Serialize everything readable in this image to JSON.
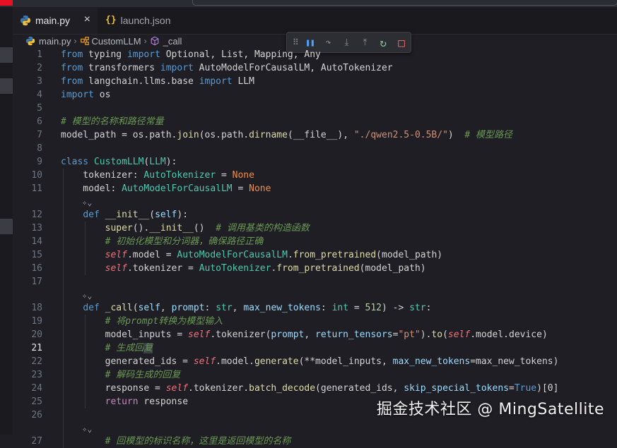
{
  "tabs": [
    {
      "label": "main.py",
      "close": "×",
      "active": true,
      "icon": "python-icon"
    },
    {
      "label": "launch.json",
      "icon": "json-braces-icon",
      "icon_glyph": "{}"
    }
  ],
  "breadcrumb": {
    "file": "main.py",
    "class": "CustomLLM",
    "method": "_call"
  },
  "debug_toolbar": {
    "grip": "⠿",
    "buttons": [
      {
        "name": "pause-icon",
        "glyph": "❚❚",
        "color": "#4fa3ff"
      },
      {
        "name": "step-over-icon",
        "glyph": "↷",
        "color": "#8a8a92"
      },
      {
        "name": "step-into-icon",
        "glyph": "⤓",
        "color": "#8a8a92"
      },
      {
        "name": "step-out-icon",
        "glyph": "⤒",
        "color": "#8a8a92"
      },
      {
        "name": "restart-icon",
        "glyph": "↻",
        "color": "#73c991"
      },
      {
        "name": "stop-icon",
        "glyph": "□",
        "color": "#f47067"
      }
    ]
  },
  "editor": {
    "current_line": 21,
    "lines": [
      {
        "n": "1",
        "t": [
          [
            "k",
            "from"
          ],
          [
            "pl",
            " typing "
          ],
          [
            "k",
            "import"
          ],
          [
            "pl",
            " Optional, List, Mapping, Any"
          ]
        ]
      },
      {
        "n": "2",
        "t": [
          [
            "k",
            "from"
          ],
          [
            "pl",
            " transformers "
          ],
          [
            "k",
            "import"
          ],
          [
            "pl",
            " AutoModelForCausalLM, AutoTokenizer"
          ]
        ]
      },
      {
        "n": "3",
        "t": [
          [
            "k",
            "from"
          ],
          [
            "pl",
            " langchain.llms.base "
          ],
          [
            "k",
            "import"
          ],
          [
            "pl",
            " LLM"
          ]
        ]
      },
      {
        "n": "4",
        "t": [
          [
            "k",
            "import"
          ],
          [
            "pl",
            " os"
          ]
        ]
      },
      {
        "n": "5",
        "t": []
      },
      {
        "n": "6",
        "t": [
          [
            "com",
            "# 模型的名称和路径常量"
          ]
        ]
      },
      {
        "n": "7",
        "t": [
          [
            "pl",
            "model_path = os.path."
          ],
          [
            "fn",
            "join"
          ],
          [
            "pl",
            "(os.path."
          ],
          [
            "fn",
            "dirname"
          ],
          [
            "pl",
            "(__file__), "
          ],
          [
            "str",
            "\"./qwen2.5-0.5B/\""
          ],
          [
            "pl",
            ")  "
          ],
          [
            "com",
            "# 模型路径"
          ]
        ]
      },
      {
        "n": "8",
        "t": []
      },
      {
        "n": "9",
        "t": [
          [
            "k",
            "class"
          ],
          [
            "pl",
            " "
          ],
          [
            "cls",
            "CustomLLM"
          ],
          [
            "pl",
            "("
          ],
          [
            "cls",
            "LLM"
          ],
          [
            "pl",
            "):"
          ]
        ]
      },
      {
        "n": "10",
        "t": [
          [
            "pl",
            "    tokenizer: "
          ],
          [
            "cls",
            "AutoTokenizer"
          ],
          [
            "pl",
            " = "
          ],
          [
            "none",
            "None"
          ]
        ]
      },
      {
        "n": "11",
        "t": [
          [
            "pl",
            "    model: "
          ],
          [
            "cls",
            "AutoModelForCausalLM"
          ],
          [
            "pl",
            " = "
          ],
          [
            "none",
            "None"
          ]
        ]
      },
      {
        "n": "12",
        "t": [
          [
            "pl",
            "    "
          ],
          [
            "k",
            "def"
          ],
          [
            "pl",
            " "
          ],
          [
            "fn",
            "__init__"
          ],
          [
            "pl",
            "("
          ],
          [
            "var",
            "self"
          ],
          [
            "pl",
            "):"
          ]
        ]
      },
      {
        "n": "13",
        "t": [
          [
            "pl",
            "        "
          ],
          [
            "fn",
            "super"
          ],
          [
            "pl",
            "()."
          ],
          [
            "fn",
            "__init__"
          ],
          [
            "pl",
            "()  "
          ],
          [
            "com",
            "# 调用基类的构造函数"
          ]
        ]
      },
      {
        "n": "14",
        "t": [
          [
            "pl",
            "        "
          ],
          [
            "com",
            "# 初始化模型和分词器，确保路径正确"
          ]
        ]
      },
      {
        "n": "15",
        "t": [
          [
            "pl",
            "        "
          ],
          [
            "self",
            "self"
          ],
          [
            "pl",
            ".model = "
          ],
          [
            "cls",
            "AutoModelForCausalLM"
          ],
          [
            "pl",
            "."
          ],
          [
            "fn",
            "from_pretrained"
          ],
          [
            "pl",
            "(model_path)"
          ]
        ]
      },
      {
        "n": "16",
        "t": [
          [
            "pl",
            "        "
          ],
          [
            "self",
            "self"
          ],
          [
            "pl",
            ".tokenizer = "
          ],
          [
            "cls",
            "AutoTokenizer"
          ],
          [
            "pl",
            "."
          ],
          [
            "fn",
            "from_pretrained"
          ],
          [
            "pl",
            "(model_path)"
          ]
        ]
      },
      {
        "n": "17",
        "t": []
      },
      {
        "n": "18",
        "t": [
          [
            "pl",
            "    "
          ],
          [
            "k",
            "def"
          ],
          [
            "pl",
            " "
          ],
          [
            "fn",
            "_call"
          ],
          [
            "pl",
            "("
          ],
          [
            "var",
            "self"
          ],
          [
            "pl",
            ", "
          ],
          [
            "var",
            "prompt"
          ],
          [
            "pl",
            ": "
          ],
          [
            "cls",
            "str"
          ],
          [
            "pl",
            ", "
          ],
          [
            "var",
            "max_new_tokens"
          ],
          [
            "pl",
            ": "
          ],
          [
            "cls",
            "int"
          ],
          [
            "pl",
            " = "
          ],
          [
            "num",
            "512"
          ],
          [
            "pl",
            ") -> "
          ],
          [
            "cls",
            "str"
          ],
          [
            "pl",
            ":"
          ]
        ]
      },
      {
        "n": "19",
        "t": [
          [
            "pl",
            "        "
          ],
          [
            "com",
            "# 将prompt转换为模型输入"
          ]
        ]
      },
      {
        "n": "20",
        "t": [
          [
            "pl",
            "        model_inputs = "
          ],
          [
            "self",
            "self"
          ],
          [
            "pl",
            ".tokenizer("
          ],
          [
            "var",
            "prompt"
          ],
          [
            "pl",
            ", "
          ],
          [
            "var",
            "return_tensors"
          ],
          [
            "pl",
            "="
          ],
          [
            "str",
            "\"pt\""
          ],
          [
            "pl",
            ")."
          ],
          [
            "fn",
            "to"
          ],
          [
            "pl",
            "("
          ],
          [
            "self",
            "self"
          ],
          [
            "pl",
            ".model.device)"
          ]
        ]
      },
      {
        "n": "21",
        "t": [
          [
            "pl",
            "        "
          ],
          [
            "com",
            "# 生成回"
          ],
          [
            "comsel",
            "复"
          ]
        ]
      },
      {
        "n": "22",
        "t": [
          [
            "pl",
            "        generated_ids = "
          ],
          [
            "self",
            "self"
          ],
          [
            "pl",
            ".model."
          ],
          [
            "fn",
            "generate"
          ],
          [
            "pl",
            "(**model_inputs, "
          ],
          [
            "var",
            "max_new_tokens"
          ],
          [
            "pl",
            "=max_new_tokens)"
          ]
        ]
      },
      {
        "n": "23",
        "t": [
          [
            "pl",
            "        "
          ],
          [
            "com",
            "# 解码生成的回复"
          ]
        ]
      },
      {
        "n": "24",
        "t": [
          [
            "pl",
            "        response = "
          ],
          [
            "self",
            "self"
          ],
          [
            "pl",
            ".tokenizer."
          ],
          [
            "fn",
            "batch_decode"
          ],
          [
            "pl",
            "(generated_ids, "
          ],
          [
            "var",
            "skip_special_tokens"
          ],
          [
            "pl",
            "="
          ],
          [
            "k",
            "True"
          ],
          [
            "pl",
            ")[0]"
          ]
        ]
      },
      {
        "n": "25",
        "t": [
          [
            "pl",
            "        "
          ],
          [
            "kf",
            "return"
          ],
          [
            "pl",
            " response"
          ]
        ]
      },
      {
        "n": "26",
        "t": []
      },
      {
        "n": "27",
        "t": [
          [
            "pl",
            "        "
          ],
          [
            "com",
            "# 回模型的标识名称，这里是返回模型的名称"
          ]
        ]
      }
    ]
  },
  "codelens": [
    {
      "before": "12",
      "glyph": "✧⌄"
    },
    {
      "before": "18",
      "glyph": "✧⌄"
    },
    {
      "before": "27",
      "glyph": "✧⌄"
    }
  ],
  "watermark": "掘金技术社区 @ MingSatellite"
}
